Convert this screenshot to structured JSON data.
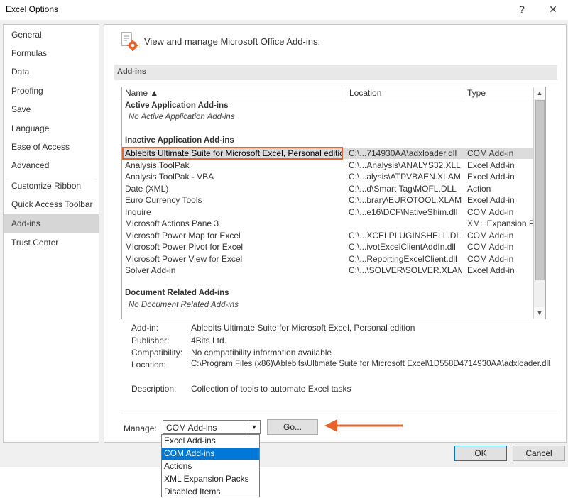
{
  "window": {
    "title": "Excel Options",
    "help": "?",
    "close": "✕"
  },
  "sidebar": {
    "items": [
      {
        "label": "General"
      },
      {
        "label": "Formulas"
      },
      {
        "label": "Data"
      },
      {
        "label": "Proofing"
      },
      {
        "label": "Save"
      },
      {
        "label": "Language"
      },
      {
        "label": "Ease of Access"
      },
      {
        "label": "Advanced"
      },
      {
        "label": "Customize Ribbon"
      },
      {
        "label": "Quick Access Toolbar"
      },
      {
        "label": "Add-ins"
      },
      {
        "label": "Trust Center"
      }
    ],
    "active": "Add-ins"
  },
  "header": {
    "text": "View and manage Microsoft Office Add-ins.",
    "icon": "addins-gear-icon"
  },
  "section": {
    "title": "Add-ins"
  },
  "table": {
    "columns": {
      "name": "Name ▲",
      "location": "Location",
      "type": "Type"
    },
    "groups": {
      "active": {
        "title": "Active Application Add-ins",
        "empty": "No Active Application Add-ins"
      },
      "inactive": {
        "title": "Inactive Application Add-ins"
      },
      "document": {
        "title": "Document Related Add-ins",
        "empty": "No Document Related Add-ins"
      }
    },
    "rows": [
      {
        "name": "Ablebits Ultimate Suite for Microsoft Excel, Personal edition",
        "location": "C:\\...714930AA\\adxloader.dll",
        "type": "COM Add-in"
      },
      {
        "name": "Analysis ToolPak",
        "location": "C:\\...Analysis\\ANALYS32.XLL",
        "type": "Excel Add-in"
      },
      {
        "name": "Analysis ToolPak - VBA",
        "location": "C:\\...alysis\\ATPVBAEN.XLAM",
        "type": "Excel Add-in"
      },
      {
        "name": "Date (XML)",
        "location": "C:\\...d\\Smart Tag\\MOFL.DLL",
        "type": "Action"
      },
      {
        "name": "Euro Currency Tools",
        "location": "C:\\...brary\\EUROTOOL.XLAM",
        "type": "Excel Add-in"
      },
      {
        "name": "Inquire",
        "location": "C:\\...e16\\DCF\\NativeShim.dll",
        "type": "COM Add-in"
      },
      {
        "name": "Microsoft Actions Pane 3",
        "location": "",
        "type": "XML Expansion Pack"
      },
      {
        "name": "Microsoft Power Map for Excel",
        "location": "C:\\...XCELPLUGINSHELL.DLL",
        "type": "COM Add-in"
      },
      {
        "name": "Microsoft Power Pivot for Excel",
        "location": "C:\\...ivotExcelClientAddIn.dll",
        "type": "COM Add-in"
      },
      {
        "name": "Microsoft Power View for Excel",
        "location": "C:\\...ReportingExcelClient.dll",
        "type": "COM Add-in"
      },
      {
        "name": "Solver Add-in",
        "location": "C:\\...\\SOLVER\\SOLVER.XLAM",
        "type": "Excel Add-in"
      }
    ]
  },
  "details": {
    "addin_label": "Add-in:",
    "addin": "Ablebits Ultimate Suite for Microsoft Excel, Personal edition",
    "publisher_label": "Publisher:",
    "publisher": "4Bits Ltd.",
    "compat_label": "Compatibility:",
    "compat": "No compatibility information available",
    "location_label": "Location:",
    "location": "C:\\Program Files (x86)\\Ablebits\\Ultimate Suite for Microsoft Excel\\1D558D4714930AA\\adxloader.dll",
    "description_label": "Description:",
    "description": "Collection of tools to automate Excel tasks"
  },
  "manage": {
    "label": "Manage:",
    "selected": "COM Add-ins",
    "go_label": "Go...",
    "options": [
      "Excel Add-ins",
      "COM Add-ins",
      "Actions",
      "XML Expansion Packs",
      "Disabled Items"
    ],
    "highlighted": "COM Add-ins"
  },
  "buttons": {
    "ok": "OK",
    "cancel": "Cancel"
  },
  "colors": {
    "highlight": "#e8632c",
    "accent": "#0078d7"
  }
}
